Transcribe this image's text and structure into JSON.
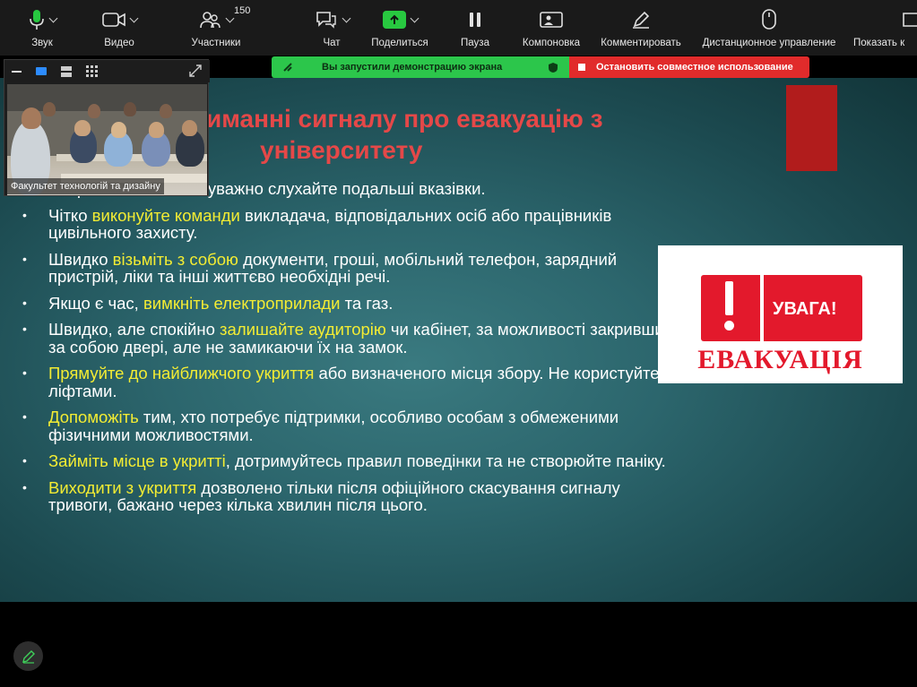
{
  "toolbar": {
    "audio_label": "Звук",
    "video_label": "Видео",
    "participants_label": "Участники",
    "participants_count": "150",
    "chat_label": "Чат",
    "share_label": "Поделиться",
    "pause_label": "Пауза",
    "layout_label": "Компоновка",
    "annotate_label": "Комментировать",
    "remote_label": "Дистанционное управление",
    "show_label": "Показать к"
  },
  "banner": {
    "sharing_text": "Вы запустили демонстрацию экрана",
    "stop_text": "Остановить совместное использование",
    "colors": {
      "green": "#2cc64b",
      "red": "#e12b2b"
    }
  },
  "slide": {
    "title_line1": "иманні сигналу про евакуацію з",
    "title_line2": "університету",
    "bullets": [
      {
        "hl": "",
        "text": "рігайте спокій та уважно слухайте подальші вказівки."
      },
      {
        "pre": "Чітко ",
        "hl": "виконуйте команди",
        "text": " викладача, відповідальних осіб або працівників цивільного захисту."
      },
      {
        "pre": "Швидко ",
        "hl": "візьміть з собою",
        "text": " документи, гроші, мобільний телефон, зарядний пристрій, ліки та інші життєво необхідні речі."
      },
      {
        "pre": "Якщо є час, ",
        "hl": "вимкніть електроприлади",
        "text": " та газ."
      },
      {
        "pre": "Швидко, але спокійно ",
        "hl": "залишайте аудиторію",
        "text": " чи кабінет, за можливості закривши за собою двері, але не замикаючи їх на замок."
      },
      {
        "pre": "",
        "hl": "Прямуйте до найближчого укриття",
        "text": " або визначеного місця збору. Не користуйтеся ліфтами."
      },
      {
        "pre": "",
        "hl": "Допоможіть",
        "text": " тим, хто потребує підтримки, особливо особам з обмеженими фізичними можливостями."
      },
      {
        "pre": "",
        "hl": "Займіть місце в укритті",
        "text": ", дотримуйтесь правил поведінки та не створюйте паніку."
      },
      {
        "pre": "",
        "hl": "Виходити з укриття",
        "text": " дозволено тільки після офіційного скасування сигналу тривоги, бажано через кілька хвилин після цього."
      }
    ],
    "image": {
      "top_text": "УВАГА!",
      "bottom_text": "ЕВАКУАЦІЯ"
    },
    "colors": {
      "title": "#e54848",
      "highlight": "#f3ec33"
    }
  },
  "video": {
    "name": "Факультет технологій та дизайну"
  },
  "icons": [
    "microphone-icon",
    "camera-icon",
    "participants-icon",
    "chat-icon",
    "share-icon",
    "pause-icon",
    "layout-icon",
    "pen-icon",
    "mouse-icon",
    "pencil-icon"
  ]
}
